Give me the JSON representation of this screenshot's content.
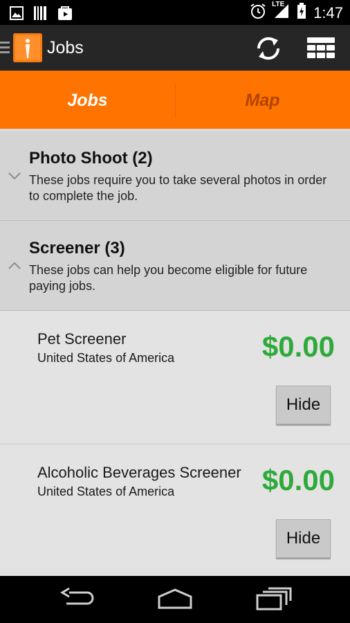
{
  "status_bar": {
    "time": "1:47",
    "network_label": "LTE",
    "icons": [
      "image-icon",
      "barcode-icon",
      "play-store-icon",
      "alarm-icon",
      "signal-icon",
      "battery-charging-icon"
    ]
  },
  "action_bar": {
    "title": "Jobs",
    "icons": [
      "up-icon",
      "app-logo-icon",
      "refresh-icon",
      "grid-menu-icon"
    ]
  },
  "tabs": [
    {
      "label": "Jobs",
      "selected": true
    },
    {
      "label": "Map",
      "selected": false
    }
  ],
  "sections": [
    {
      "title": "Photo Shoot (2)",
      "description": "These jobs require you to take several photos in order to complete the job.",
      "expanded": false
    },
    {
      "title": "Screener (3)",
      "description": "These jobs can help you become eligible for future paying jobs.",
      "expanded": true
    }
  ],
  "jobs": [
    {
      "name": "Pet Screener",
      "location": "United States of America",
      "price": "$0.00",
      "hide_label": "Hide"
    },
    {
      "name": "Alcoholic Beverages Screener",
      "location": "United States of America",
      "price": "$0.00",
      "hide_label": "Hide"
    }
  ],
  "colors": {
    "accent_orange": "#ff7300",
    "price_green": "#2eaa3a",
    "action_bar": "#262626"
  },
  "nav_bar": {
    "icons": [
      "back-icon",
      "home-icon",
      "recent-apps-icon"
    ]
  }
}
